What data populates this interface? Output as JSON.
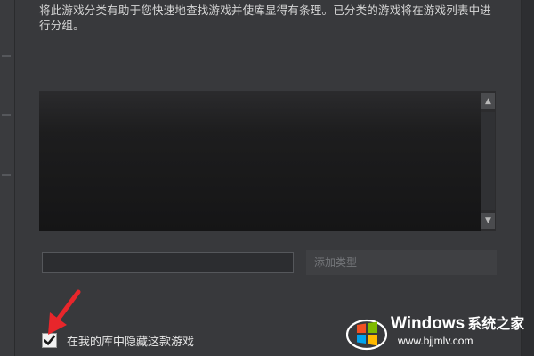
{
  "dialog": {
    "description": "将此游戏分类有助于您快速地查找游戏并使库显得有条理。已分类的游戏将在游戏列表中进行分组。",
    "category_input": {
      "value": "",
      "placeholder": ""
    },
    "add_category_label": "添加类型",
    "hide_checkbox": {
      "label": "在我的库中隐藏这款游戏",
      "checked": true
    },
    "scrollbar": {
      "up_glyph": "▲",
      "down_glyph": "▼"
    }
  },
  "watermark": {
    "brand": "Windows",
    "brand_cn": "系统之家",
    "url": "www.bjjmlv.com"
  },
  "annotation": {
    "arrow_color": "#e8262b"
  },
  "icons": {
    "checkmark": "checkmark-icon",
    "arrow": "red-arrow-icon",
    "logo": "windows-logo-icon"
  }
}
